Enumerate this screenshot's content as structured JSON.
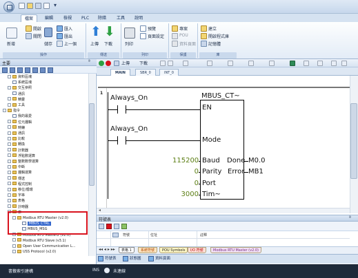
{
  "menu": {
    "tabs": [
      "檔案",
      "編輯",
      "檢視",
      "PLC",
      "除錯",
      "工具",
      "說明"
    ],
    "active_index": 0
  },
  "ribbon": {
    "new_label": "新增",
    "open_label": "開啟",
    "save_label": "儲存",
    "import_label": "匯入",
    "export_label": "匯出",
    "previous_label": "上一個",
    "close_label": "關閉",
    "upload_label": "上傳",
    "download_label": "下載",
    "print_label": "列印",
    "preview_label": "預覽",
    "page_setup_label": "頁面設定",
    "project_label": "專案",
    "pou_label": "POU",
    "data_page_label": "資料頁面",
    "create_label": "建立",
    "open_project_label": "開啟程式庫",
    "memory_label": "記憶體",
    "groups": [
      "操作",
      "傳送",
      "列印",
      "保護",
      "庫"
    ]
  },
  "tree": {
    "header": "主要",
    "items": [
      {
        "indent": 1,
        "label": "資料區塊",
        "type": "folder"
      },
      {
        "indent": 1,
        "label": "系統區塊",
        "type": "doc"
      },
      {
        "indent": 1,
        "label": "交互參照",
        "type": "folder"
      },
      {
        "indent": 1,
        "label": "通訊",
        "type": "doc"
      },
      {
        "indent": 1,
        "label": "精靈",
        "type": "folder"
      },
      {
        "indent": 1,
        "label": "工具",
        "type": "folder"
      },
      {
        "indent": 0,
        "label": "指令",
        "type": "folder"
      },
      {
        "indent": 1,
        "label": "我的最愛",
        "type": "doc"
      },
      {
        "indent": 1,
        "label": "位元邏輯",
        "type": "folder"
      },
      {
        "indent": 1,
        "label": "時鐘",
        "type": "folder"
      },
      {
        "indent": 1,
        "label": "通訊",
        "type": "folder"
      },
      {
        "indent": 1,
        "label": "比較",
        "type": "folder"
      },
      {
        "indent": 1,
        "label": "轉換",
        "type": "folder"
      },
      {
        "indent": 1,
        "label": "計數器",
        "type": "folder"
      },
      {
        "indent": 1,
        "label": "浮點數運算",
        "type": "folder"
      },
      {
        "indent": 1,
        "label": "整數數學運算",
        "type": "folder"
      },
      {
        "indent": 1,
        "label": "中斷",
        "type": "folder"
      },
      {
        "indent": 1,
        "label": "邏輯運算",
        "type": "folder"
      },
      {
        "indent": 1,
        "label": "傳送",
        "type": "folder"
      },
      {
        "indent": 1,
        "label": "程式控制",
        "type": "folder"
      },
      {
        "indent": 1,
        "label": "移位/循環",
        "type": "folder"
      },
      {
        "indent": 1,
        "label": "字串",
        "type": "folder"
      },
      {
        "indent": 1,
        "label": "表格",
        "type": "folder"
      },
      {
        "indent": 1,
        "label": "計時器",
        "type": "folder"
      },
      {
        "indent": 1,
        "label": "庫",
        "type": "folder"
      },
      {
        "indent": 2,
        "label": "Modbus RTU Master (v2.0)",
        "type": "folder"
      },
      {
        "indent": 3,
        "label": "MBUS_CTRL",
        "type": "doc",
        "selected": true
      },
      {
        "indent": 3,
        "label": "MBUS_MSG",
        "type": "doc"
      },
      {
        "indent": 2,
        "label": "Modbus RTU Master2 (v2.0)",
        "type": "folder"
      },
      {
        "indent": 2,
        "label": "Modbus RTU Slave (v3.1)",
        "type": "folder"
      },
      {
        "indent": 2,
        "label": "Open User Communication L...",
        "type": "folder"
      },
      {
        "indent": 2,
        "label": "USS Protocol (v2.0)",
        "type": "folder"
      }
    ]
  },
  "editor": {
    "tabs": [
      "MAIN",
      "SBR_0",
      "INT_0"
    ],
    "active_tab": 0,
    "network_number": "1",
    "contact1_label": "Always_On",
    "contact2_label": "Always_On",
    "block_name": "MBUS_CT~",
    "pin_en": "EN",
    "pin_mode": "Mode",
    "pin_baud": "Baud",
    "pin_parity": "Parity",
    "pin_port": "Port",
    "pin_timeout": "Tim~",
    "pin_done": "Done",
    "pin_error": "Error",
    "val_baud": "115200",
    "val_parity": "0",
    "val_port": "0",
    "val_timeout": "3000",
    "out_done": "M0.0",
    "out_error": "MB1"
  },
  "symbols": {
    "header": "符號表",
    "columns": [
      "符號",
      "位址",
      "註釋"
    ],
    "sheet_nav": "表格 1",
    "tabs": [
      "系統符號",
      "POU Symbols",
      "I/O 符號",
      "Modbus RTU Master (v2.0)"
    ]
  },
  "bottom_tabs": [
    "符號表",
    "狀態圖",
    "資料頁面"
  ],
  "status": {
    "left_text": "書籤索引建構",
    "mode": "INS",
    "connection": "未連線"
  },
  "colors": {
    "selection": "#3366cc",
    "highlight_box": "#d8121d",
    "value_text": "#5a7d12"
  }
}
